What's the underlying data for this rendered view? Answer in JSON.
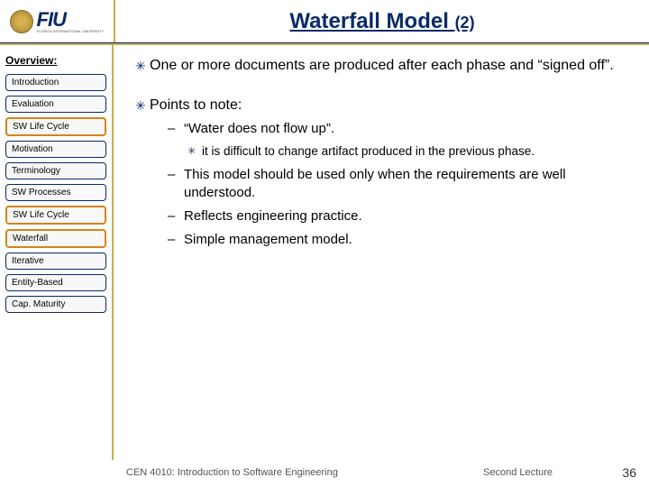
{
  "header": {
    "logo_text": "FIU",
    "logo_subtitle": "FLORIDA INTERNATIONAL UNIVERSITY",
    "title_main": "Waterfall Model ",
    "title_sub": "(2)"
  },
  "sidebar": {
    "heading": "Overview:",
    "items": [
      {
        "label": "Introduction",
        "active": false
      },
      {
        "label": "Evaluation",
        "active": false
      },
      {
        "label": "SW Life Cycle",
        "active": true
      },
      {
        "label": "Motivation",
        "active": false
      },
      {
        "label": "Terminology",
        "active": false
      },
      {
        "label": "SW Processes",
        "active": false
      },
      {
        "label": "SW Life Cycle",
        "active": true
      },
      {
        "label": "Waterfall",
        "active": true
      },
      {
        "label": "Iterative",
        "active": false
      },
      {
        "label": "Entity-Based",
        "active": false
      },
      {
        "label": "Cap. Maturity",
        "active": false
      }
    ]
  },
  "content": {
    "bullets": [
      {
        "text": "One or more documents are produced after each phase and “signed off”."
      },
      {
        "text": "Points to note:",
        "subs": [
          {
            "text": "“Water does not flow up”.",
            "subsub": "it is difficult to change artifact produced in the previous phase."
          },
          {
            "text": "This model should be used only when the requirements are well understood."
          },
          {
            "text": "Reflects engineering practice."
          },
          {
            "text": "Simple management model."
          }
        ]
      }
    ]
  },
  "footer": {
    "left": "CEN 4010: Introduction to Software Engineering",
    "mid": "Second Lecture",
    "page": "36"
  }
}
